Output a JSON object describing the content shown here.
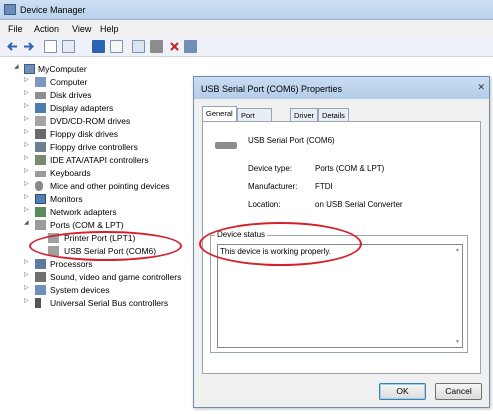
{
  "device_manager": {
    "title": "Device Manager",
    "menu": [
      "File",
      "Action",
      "View",
      "Help"
    ],
    "toolbar_icons": [
      "back-arrow-icon",
      "forward-arrow-icon",
      "show-tree-icon",
      "properties-icon",
      "help-icon",
      "view-icon",
      "scan-hardware-icon",
      "uninstall-icon",
      "disable-icon",
      "update-driver-icon"
    ],
    "tree": {
      "root": "MyComputer",
      "nodes": [
        {
          "label": "Computer",
          "icon": "computer-icon"
        },
        {
          "label": "Disk drives",
          "icon": "disk-drive-icon"
        },
        {
          "label": "Display adapters",
          "icon": "display-adapter-icon"
        },
        {
          "label": "DVD/CD-ROM drives",
          "icon": "dvd-drive-icon"
        },
        {
          "label": "Floppy disk drives",
          "icon": "floppy-disk-icon"
        },
        {
          "label": "Floppy drive controllers",
          "icon": "floppy-controller-icon"
        },
        {
          "label": "IDE ATA/ATAPI controllers",
          "icon": "ide-controller-icon"
        },
        {
          "label": "Keyboards",
          "icon": "keyboard-icon"
        },
        {
          "label": "Mice and other pointing devices",
          "icon": "mouse-icon"
        },
        {
          "label": "Monitors",
          "icon": "monitor-icon"
        },
        {
          "label": "Network adapters",
          "icon": "network-adapter-icon"
        },
        {
          "label": "Ports (COM & LPT)",
          "icon": "port-icon"
        },
        {
          "label": "Printer Port (LPT1)",
          "icon": "printer-port-icon"
        },
        {
          "label": "USB Serial Port (COM6)",
          "icon": "usb-serial-port-icon"
        },
        {
          "label": "Processors",
          "icon": "processor-icon"
        },
        {
          "label": "Sound, video and game controllers",
          "icon": "sound-icon"
        },
        {
          "label": "System devices",
          "icon": "system-devices-icon"
        },
        {
          "label": "Universal Serial Bus controllers",
          "icon": "usb-controller-icon"
        }
      ]
    }
  },
  "dialog": {
    "title": "USB Serial Port (COM6) Properties",
    "close_glyph": "✕",
    "tabs": [
      "General",
      "Port Settings",
      "Driver",
      "Details"
    ],
    "active_tab": "General",
    "device_name": "USB Serial Port (COM6)",
    "fields": [
      {
        "label": "Device type:",
        "value": "Ports (COM & LPT)"
      },
      {
        "label": "Manufacturer:",
        "value": "FTDI"
      },
      {
        "label": "Location:",
        "value": "on USB Serial Converter"
      }
    ],
    "status_label": "Device status",
    "status_text": "This device is working properly.",
    "ok_label": "OK",
    "cancel_label": "Cancel"
  },
  "colors": {
    "annotation_red": "#d6202b",
    "title_bar": "#c9dcf2"
  }
}
